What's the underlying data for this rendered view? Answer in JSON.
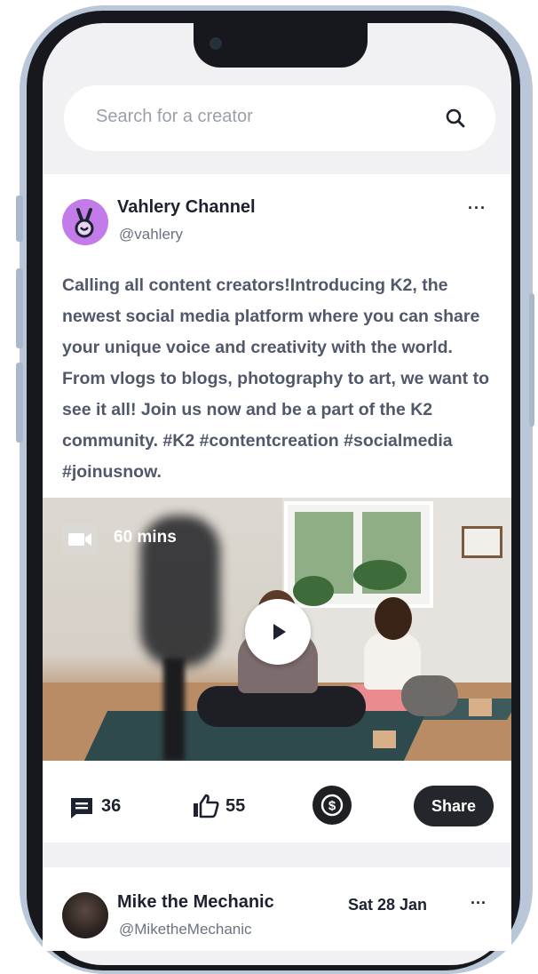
{
  "search": {
    "placeholder": "Search for a creator"
  },
  "post1": {
    "author_name": "Vahlery Channel",
    "author_handle": "@vahlery",
    "text": "Calling all content creators!Introducing K2, the newest social media platform where you can share your unique voice and creativity with the world. From vlogs to blogs, photography to art, we want to see it all! Join us now and be a part of the K2 community. #K2 #contentcreation #socialmedia #joinusnow.",
    "video_duration": "60 mins",
    "comments_count": "36",
    "likes_count": "55",
    "share_label": "Share",
    "more_label": "···"
  },
  "post2": {
    "author_name": "Mike the Mechanic",
    "author_handle": "@MiketheMechanic",
    "date": "Sat 28 Jan",
    "more_label": "···"
  },
  "icons": {
    "search": "search-icon",
    "more": "more-horizontal-icon",
    "video": "video-camera-icon",
    "play": "play-icon",
    "comment": "comment-icon",
    "like": "thumbs-up-icon",
    "tip": "dollar-coin-icon"
  },
  "colors": {
    "accent_avatar": "#c27be8",
    "dark_button": "#23262a",
    "text_primary": "#1d2230",
    "text_secondary": "#50586a",
    "background": "#f1f1f3"
  }
}
